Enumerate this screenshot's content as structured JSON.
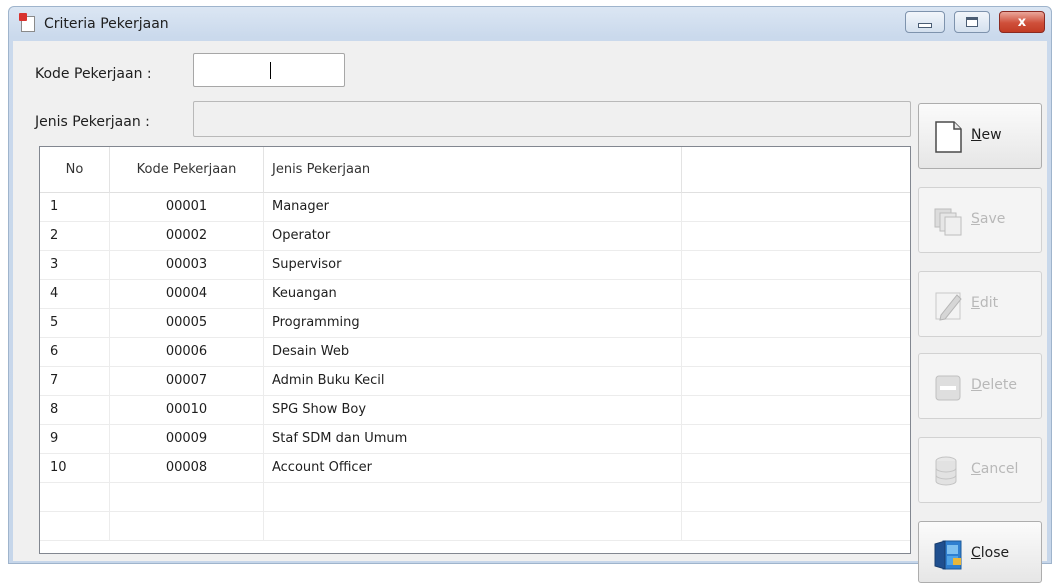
{
  "window": {
    "title": "Criteria Pekerjaan",
    "close_glyph": "x"
  },
  "form": {
    "kode_label": "Kode Pekerjaan :",
    "kode_value": "",
    "jenis_label": "Jenis Pekerjaan :",
    "jenis_value": ""
  },
  "grid": {
    "columns": [
      "No",
      "Kode Pekerjaan",
      "Jenis Pekerjaan"
    ],
    "rows": [
      {
        "no": "1",
        "kode": "00001",
        "jenis": "Manager"
      },
      {
        "no": "2",
        "kode": "00002",
        "jenis": "Operator"
      },
      {
        "no": "3",
        "kode": "00003",
        "jenis": "Supervisor"
      },
      {
        "no": "4",
        "kode": "00004",
        "jenis": "Keuangan"
      },
      {
        "no": "5",
        "kode": "00005",
        "jenis": "Programming"
      },
      {
        "no": "6",
        "kode": "00006",
        "jenis": "Desain Web"
      },
      {
        "no": "7",
        "kode": "00007",
        "jenis": "Admin Buku Kecil"
      },
      {
        "no": "8",
        "kode": "00010",
        "jenis": "SPG  Show Boy"
      },
      {
        "no": "9",
        "kode": "00009",
        "jenis": "Staf SDM dan Umum"
      },
      {
        "no": "10",
        "kode": "00008",
        "jenis": "Account Officer"
      }
    ]
  },
  "buttons": {
    "new": {
      "label": "New",
      "icon": "new-document-icon",
      "enabled": true
    },
    "save": {
      "label": "Save",
      "icon": "save-copy-icon",
      "enabled": false
    },
    "edit": {
      "label": "Edit",
      "icon": "edit-pencil-icon",
      "enabled": false
    },
    "delete": {
      "label": "Delete",
      "icon": "delete-minus-icon",
      "enabled": false
    },
    "cancel": {
      "label": "Cancel",
      "icon": "cancel-database-icon",
      "enabled": false
    },
    "close": {
      "label": "Close",
      "icon": "exit-door-icon",
      "enabled": true
    }
  },
  "colors": {
    "window_frame": "#c6d6ea",
    "client_bg": "#f0f0f0",
    "close_button": "#c23c25",
    "disabled_text": "#b8b8b8"
  }
}
